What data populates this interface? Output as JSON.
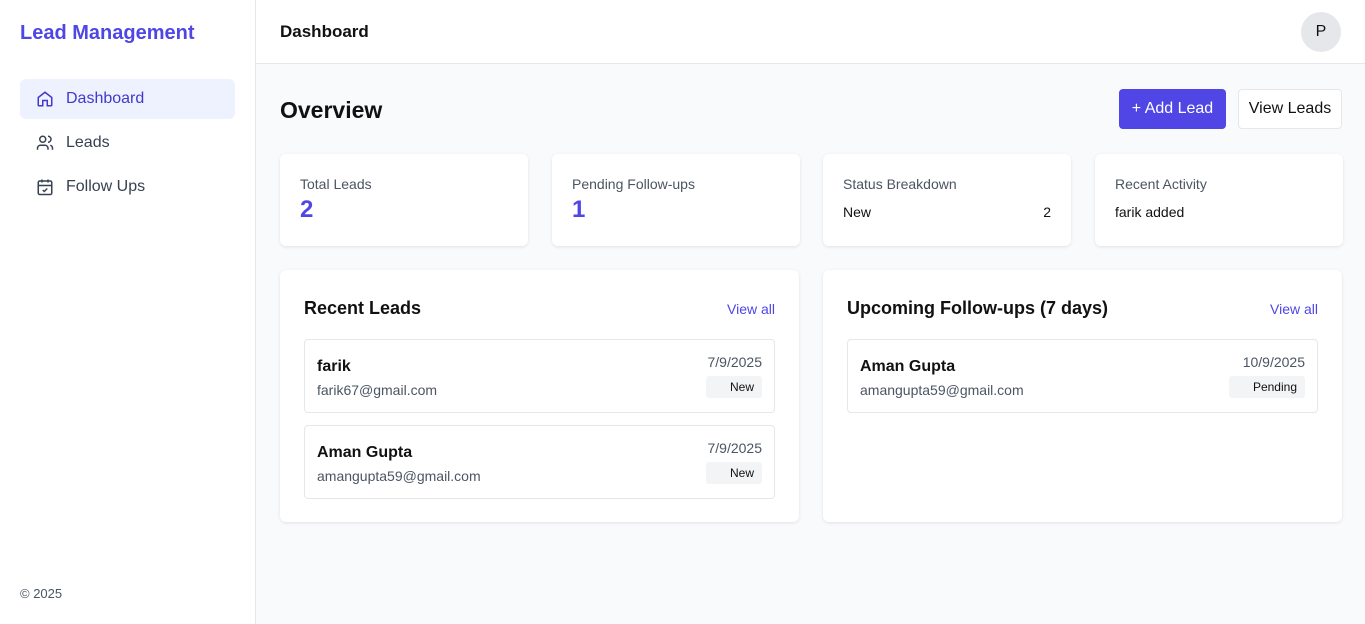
{
  "sidebar": {
    "brand": "Lead Management",
    "items": [
      {
        "label": "Dashboard",
        "icon": "home-icon"
      },
      {
        "label": "Leads",
        "icon": "users-icon"
      },
      {
        "label": "Follow Ups",
        "icon": "calendar-check-icon"
      }
    ],
    "footer": "© 2025"
  },
  "header": {
    "title": "Dashboard",
    "avatar": "P"
  },
  "overview": {
    "title": "Overview",
    "add_lead": "+ Add Lead",
    "view_leads": "View Leads"
  },
  "stats": {
    "total_label": "Total Leads",
    "total": "2",
    "pending_label": "Pending Follow-ups",
    "pending": "1",
    "status_label": "Status Breakdown",
    "status_name": "New",
    "status_count": "2",
    "activity_label": "Recent Activity",
    "activity": "farik added"
  },
  "recent": {
    "title": "Recent Leads",
    "view_all": "View all",
    "items": [
      {
        "name": "farik",
        "email": "farik67@gmail.com",
        "date": "7/9/2025",
        "status": "New"
      },
      {
        "name": "Aman Gupta",
        "email": "amangupta59@gmail.com",
        "date": "7/9/2025",
        "status": "New"
      }
    ]
  },
  "followups": {
    "title": "Upcoming Follow-ups (7 days)",
    "view_all": "View all",
    "items": [
      {
        "name": "Aman Gupta",
        "email": "amangupta59@gmail.com",
        "date": "10/9/2025",
        "status": "Pending"
      }
    ]
  }
}
